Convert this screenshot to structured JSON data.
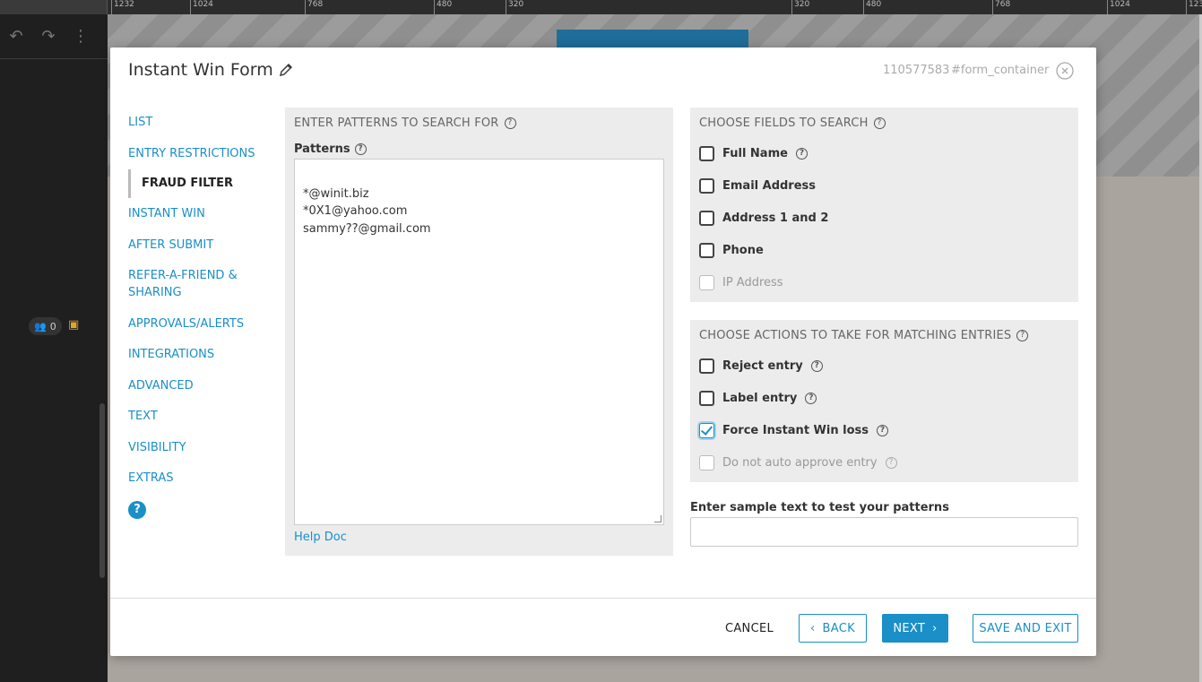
{
  "ruler": {
    "ticks": [
      "1232",
      "1024",
      "768",
      "480",
      "320",
      "320",
      "480",
      "768",
      "1024",
      "123"
    ]
  },
  "sidebar": {
    "users_count": "0"
  },
  "modal": {
    "title": "Instant Win Form",
    "id": "110577583",
    "container": "#form_container"
  },
  "nav": {
    "items": [
      {
        "label": "LIST"
      },
      {
        "label": "ENTRY RESTRICTIONS"
      },
      {
        "label": "FRAUD FILTER"
      },
      {
        "label": "INSTANT WIN"
      },
      {
        "label": "AFTER SUBMIT"
      },
      {
        "label": "REFER-A-FRIEND & SHARING"
      },
      {
        "label": "APPROVALS/ALERTS"
      },
      {
        "label": "INTEGRATIONS"
      },
      {
        "label": "ADVANCED"
      },
      {
        "label": "TEXT"
      },
      {
        "label": "VISIBILITY"
      },
      {
        "label": "EXTRAS"
      }
    ],
    "help": "?"
  },
  "patterns": {
    "heading": "ENTER PATTERNS TO SEARCH FOR",
    "label": "Patterns",
    "value": "*@winit.biz\n*0X1@yahoo.com\nsammy??@gmail.com",
    "help_link": "Help Doc"
  },
  "fields": {
    "heading": "CHOOSE FIELDS TO SEARCH",
    "options": [
      {
        "label": "Full Name",
        "checked": false
      },
      {
        "label": "Email Address",
        "checked": false
      },
      {
        "label": "Address 1 and 2",
        "checked": false
      },
      {
        "label": "Phone",
        "checked": false
      },
      {
        "label": "IP Address",
        "checked": false
      }
    ]
  },
  "actions": {
    "heading": "CHOOSE ACTIONS TO TAKE FOR MATCHING ENTRIES",
    "options": [
      {
        "label": "Reject entry",
        "checked": false
      },
      {
        "label": "Label entry",
        "checked": false
      },
      {
        "label": "Force Instant Win loss",
        "checked": true
      },
      {
        "label": "Do not auto approve entry",
        "checked": false
      }
    ]
  },
  "sample": {
    "label": "Enter sample text to test your patterns",
    "value": ""
  },
  "footer": {
    "cancel": "CANCEL",
    "back": "BACK",
    "next": "NEXT",
    "save_exit": "SAVE AND EXIT"
  },
  "colors": {
    "accent": "#1a8fc8",
    "panel": "#ececec"
  }
}
